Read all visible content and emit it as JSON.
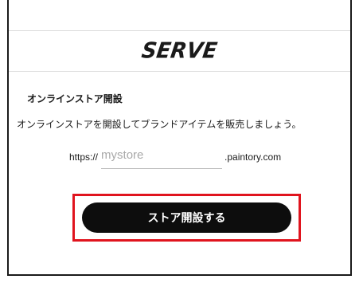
{
  "header": {
    "logo_text": "SERVE"
  },
  "section": {
    "title": "オンラインストア開設",
    "description": "オンラインストアを開設してブランドアイテムを販売しましょう。"
  },
  "url_field": {
    "prefix": "https://",
    "placeholder": "mystore",
    "suffix": ".paintory.com"
  },
  "actions": {
    "open_store_label": "ストア開設する"
  },
  "colors": {
    "button_bg": "#0d0d0d",
    "highlight_border": "#e0141e"
  }
}
